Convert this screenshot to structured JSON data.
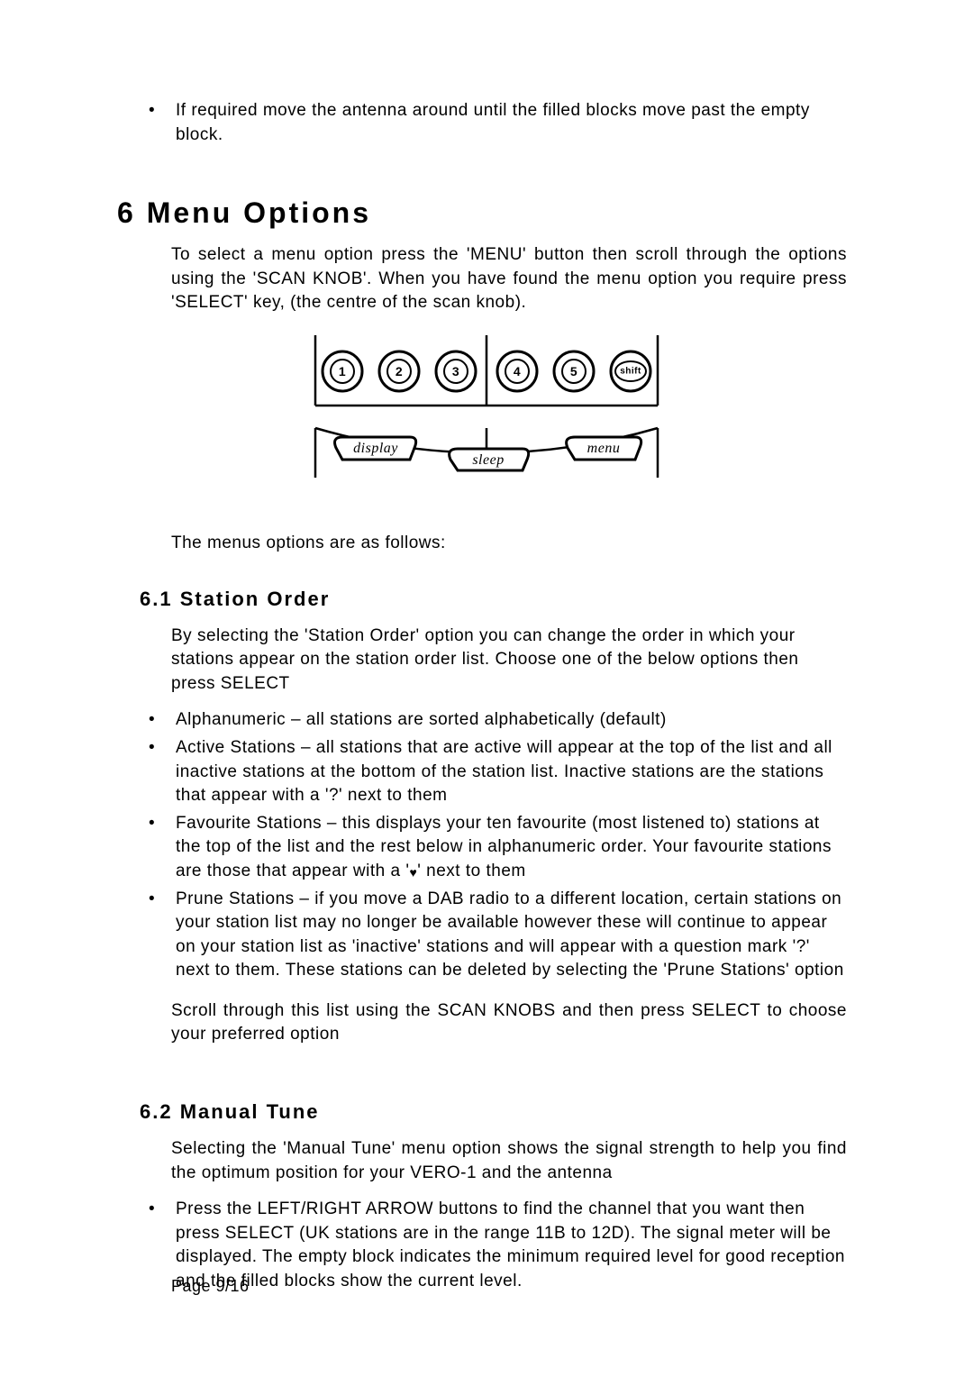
{
  "topBullet": "If required move the antenna around until the filled blocks move past the empty block.",
  "section6": {
    "heading": "6  Menu Options",
    "intro": "To select a menu option press the 'MENU' button then scroll through the options using the 'SCAN KNOB'. When you have found the menu option you require press 'SELECT' key, (the centre of the scan knob).",
    "afterDiagram": "The menus options are as follows:"
  },
  "diagram": {
    "buttons": [
      "1",
      "2",
      "3",
      "4",
      "5",
      "shift"
    ],
    "tabs": [
      "display",
      "sleep",
      "menu"
    ]
  },
  "section6_1": {
    "heading": "6.1  Station Order",
    "intro": "By selecting the 'Station Order' option you can change the order in which your stations appear on the station order list. Choose one of the below options then press SELECT",
    "items": {
      "a": "Alphanumeric – all stations are sorted alphabetically (default)",
      "b": "Active Stations – all stations that are active will appear at the top of the list and all inactive stations at the bottom of the station list. Inactive stations are the stations that appear with a '?' next to them",
      "c_pre": "Favourite Stations – this displays your ten favourite (most listened to) stations at the top of the list and the rest below in alphanumeric order. Your favourite stations are those that appear with a '",
      "c_post": "' next to them",
      "d": "Prune Stations – if you move a DAB radio to a different location, certain stations on your station list may no longer be available however these will continue to appear on your station list as 'inactive' stations and will appear with a question mark '?' next to them. These stations can be deleted by selecting the 'Prune Stations' option"
    },
    "outro": "Scroll through this list using the SCAN KNOBS and then press SELECT to choose your preferred option"
  },
  "section6_2": {
    "heading": "6.2  Manual Tune",
    "intro": "Selecting the 'Manual Tune' menu option shows the signal strength to help you find the optimum position for your VERO-1 and the antenna",
    "bullet": "Press the LEFT/RIGHT ARROW buttons to find the channel that you want then press SELECT (UK stations are in the range 11B to 12D). The signal meter will be displayed. The empty block indicates the minimum required level for good reception and the filled blocks show the current level."
  },
  "footer": "Page 9/16"
}
